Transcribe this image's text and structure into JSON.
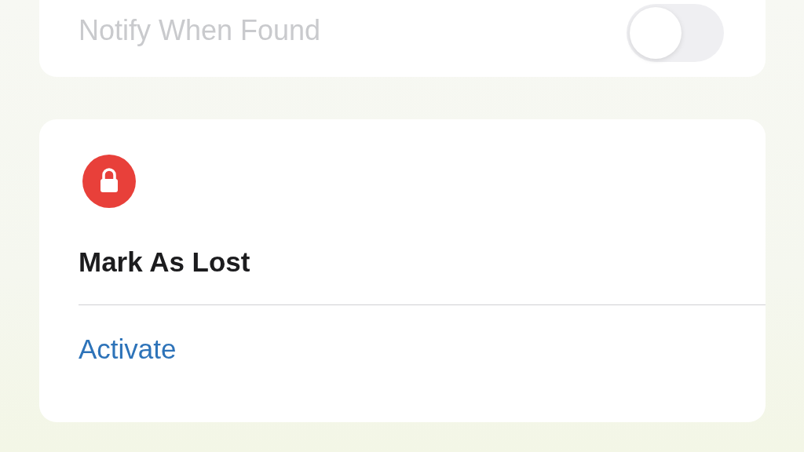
{
  "notify_card": {
    "label": "Notify When Found",
    "on": false,
    "disabled": true
  },
  "lost_card": {
    "title": "Mark As Lost",
    "action": "Activate"
  }
}
